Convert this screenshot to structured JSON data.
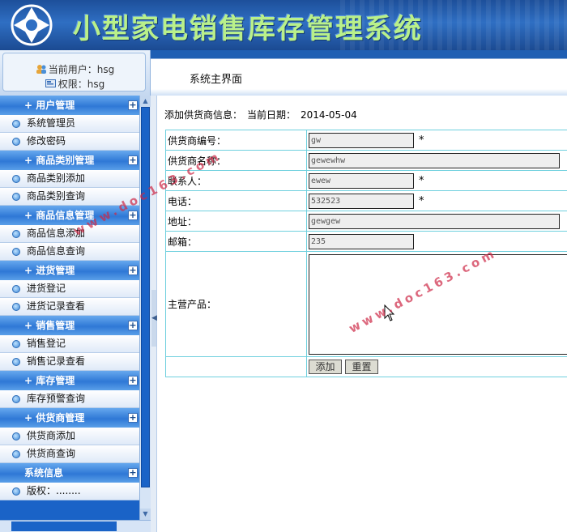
{
  "app": {
    "title": "小型家电销售库存管理系统"
  },
  "user_panel": {
    "user_label": "当前用户：hsg",
    "role_label": "权限：hsg"
  },
  "topbar": {
    "breadcrumb": "系统主界面"
  },
  "sidebar": {
    "groups": [
      {
        "label": "用户管理",
        "items": [
          "系统管理员",
          "修改密码"
        ]
      },
      {
        "label": "商品类别管理",
        "items": [
          "商品类别添加",
          "商品类别查询"
        ]
      },
      {
        "label": "商品信息管理",
        "items": [
          "商品信息添加",
          "商品信息查询"
        ]
      },
      {
        "label": "进货管理",
        "items": [
          "进货登记",
          "进货记录查看"
        ]
      },
      {
        "label": "销售管理",
        "items": [
          "销售登记",
          "销售记录查看"
        ]
      },
      {
        "label": "库存管理",
        "items": [
          "库存预警查询"
        ]
      },
      {
        "label": "供货商管理",
        "items": [
          "供货商添加",
          "供货商查询"
        ]
      },
      {
        "label": "系统信息",
        "items": [
          "版权：........"
        ]
      }
    ],
    "expand_symbol": "+"
  },
  "main": {
    "heading": "添加供货商信息：",
    "date_label": "当前日期：",
    "date_value": "2014-05-04",
    "required_mark": "*",
    "form": {
      "fields": [
        {
          "label": "供货商编号：",
          "value": "gw"
        },
        {
          "label": "供货商名称：",
          "value": "gewewhw"
        },
        {
          "label": "联系人：",
          "value": "ewew"
        },
        {
          "label": "电话：",
          "value": "532523"
        },
        {
          "label": "地址：",
          "value": "gewgew"
        },
        {
          "label": "邮箱：",
          "value": "235"
        },
        {
          "label": "主营产品：",
          "value": ""
        }
      ],
      "add_button": "添加",
      "reset_button": "重置"
    }
  },
  "watermark": {
    "text": "www.doc163.com"
  },
  "colors": {
    "header": "#2f6fc3",
    "title_text": "#b9f08a",
    "sidebar": "#1a63c7",
    "table_border": "#6fd0de"
  }
}
